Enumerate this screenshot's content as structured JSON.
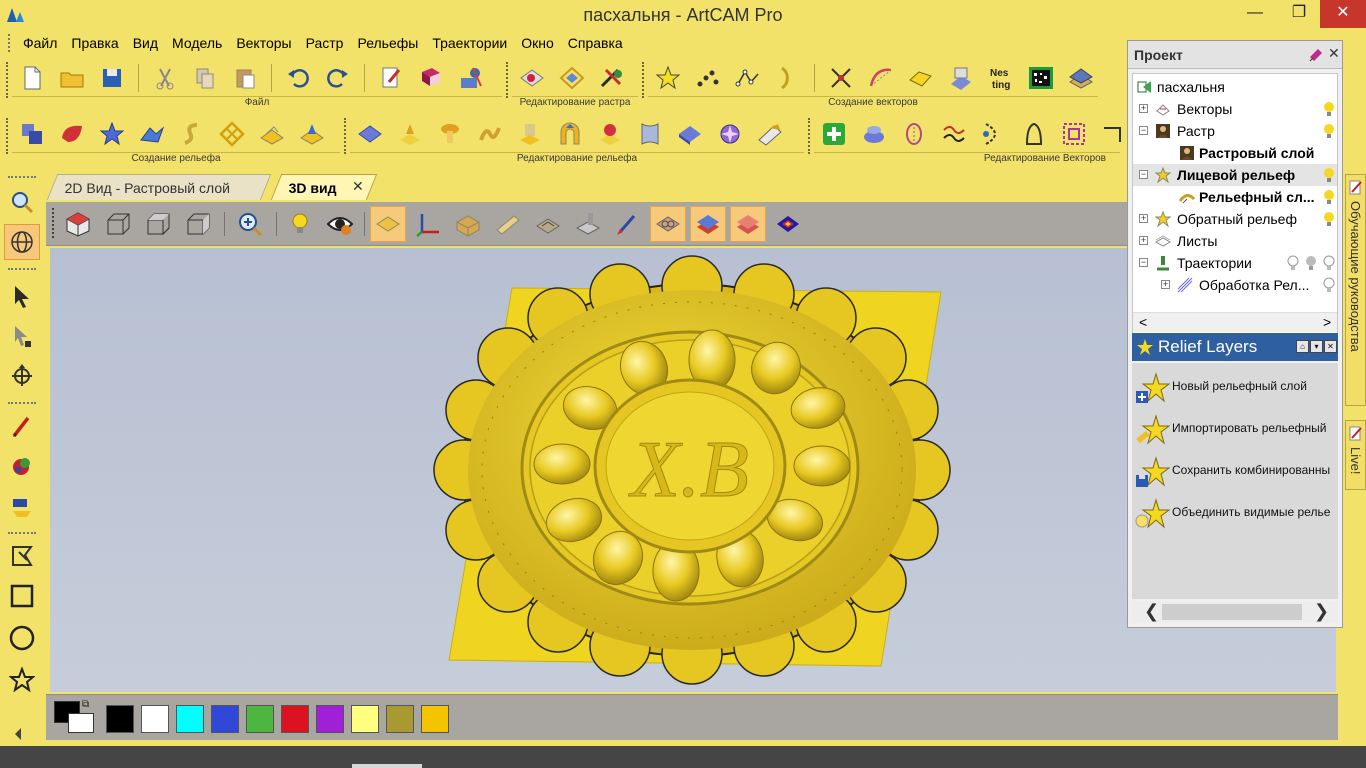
{
  "window": {
    "title": "пасхальня - ArtCAM Pro",
    "minimize": "—",
    "maximize": "❐",
    "close": "✕"
  },
  "menu": [
    "Файл",
    "Правка",
    "Вид",
    "Модель",
    "Векторы",
    "Растр",
    "Рельефы",
    "Траектории",
    "Окно",
    "Справка"
  ],
  "toolbars": {
    "file": "Файл",
    "raster_edit": "Редактирование растра",
    "vector_create": "Создание векторов",
    "relief_create": "Создание рельефа",
    "relief_edit": "Редактирование рельефа",
    "vector_edit": "Редактирование Векторов"
  },
  "tabs": {
    "tab_2d": "2D Вид - Растровый слой",
    "tab_3d": "3D вид",
    "close": "✕"
  },
  "palette": {
    "colors": [
      "#000000",
      "#ffffff",
      "#00ffff",
      "#2f48d8",
      "#4cb640",
      "#dd1220",
      "#a020d8",
      "#ffff80",
      "#a89a30",
      "#f4c400"
    ],
    "fg": "#000000",
    "bg": "#ffffff"
  },
  "project": {
    "title": "Проект",
    "close": "✕",
    "tree": {
      "root": "пасхальня",
      "vectors": "Векторы",
      "raster": "Растр",
      "raster_layer": "Растровый слой",
      "front_relief": "Лицевой рельеф",
      "relief_layer": "Рельефный сл...",
      "back_relief": "Обратный рельеф",
      "sheets": "Листы",
      "toolpaths": "Траектории",
      "machining": "Обработка Рел..."
    },
    "expand": "+",
    "collapse": "−",
    "scroll_left": "<",
    "scroll_right": ">"
  },
  "relief_layers": {
    "title": "Relief Layers",
    "items": [
      "Новый рельефный слой",
      "Импортировать рельефный",
      "Сохранить комбинированны",
      "Объединить видимые релье"
    ],
    "scroll_left": "❮",
    "scroll_right": "❯"
  },
  "side_tabs": {
    "tutorials": "Обучающие руководства",
    "live": "Live!"
  },
  "plate_text": "Х.В"
}
